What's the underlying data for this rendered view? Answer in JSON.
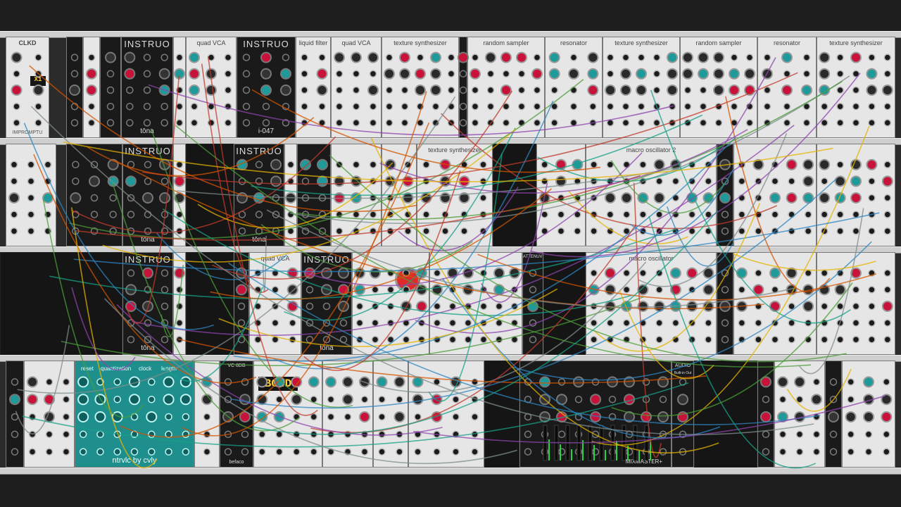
{
  "modules": {
    "clock": {
      "title": "CLKD",
      "brand": "IMPROMPTU"
    },
    "instruo_1": {
      "title": "INSTRUO",
      "brand": "tōna"
    },
    "instruo_2": {
      "title": "INSTRUO",
      "brand": "i-047"
    },
    "instruo_3": {
      "title": "INSTRUO",
      "brand": "tōna"
    },
    "instruo_4": {
      "title": "INSTRUO",
      "brand": "tōna"
    },
    "instruo_5": {
      "title": "INSTRUO",
      "brand": "tōna"
    },
    "instruo_6": {
      "title": "INSTRUO",
      "brand": "tōna"
    },
    "quad_vca_1": {
      "title": "quad VCA"
    },
    "quad_vca_2": {
      "title": "quad VCA"
    },
    "quad_vca_3": {
      "title": "quad VCA"
    },
    "liquid_filter": {
      "title": "liquid filter"
    },
    "texture_synth_1": {
      "title": "texture synthesizer"
    },
    "texture_synth_2": {
      "title": "texture synthesizer"
    },
    "texture_synth_3": {
      "title": "texture synthesizer"
    },
    "texture_synth_4": {
      "title": "texture synthesizer"
    },
    "random_sampler_1": {
      "title": "random sampler"
    },
    "random_sampler_2": {
      "title": "random sampler"
    },
    "resonator_1": {
      "title": "resonator"
    },
    "resonator_2": {
      "title": "resonator"
    },
    "macro_osc": {
      "title": "macro oscillator"
    },
    "macro_osc_2": {
      "title": "macro oscillator 2"
    },
    "sequencer": {
      "title_quant": "quantization",
      "title_clock": "clock",
      "title_length": "length",
      "title_reset": "reset",
      "brand": "ntrvlc by cvly"
    },
    "bow_display": {
      "display": "BOWD"
    },
    "mixer": {
      "brand": "MIXMASTER+"
    },
    "audio": {
      "title": "AUDIO",
      "device": "Built-in Out"
    },
    "vc_mixer": {
      "title": "VC 8DB",
      "brand": "befaco"
    },
    "attenuverter": {
      "title": "ATTENUVERTER"
    }
  },
  "colors": {
    "rack_bg": "#2b2b2b",
    "panel_light": "#e6e6e6",
    "panel_dark": "#1a1a1a",
    "teal": "#1f8f8e",
    "knob_red": "#c8123a",
    "knob_teal": "#1e9a9a",
    "cable_palette": [
      "#e4b400",
      "#4b9c3a",
      "#c0392b",
      "#8e44ad",
      "#2e86c1",
      "#16a085",
      "#d35400",
      "#7f8c8d"
    ]
  }
}
